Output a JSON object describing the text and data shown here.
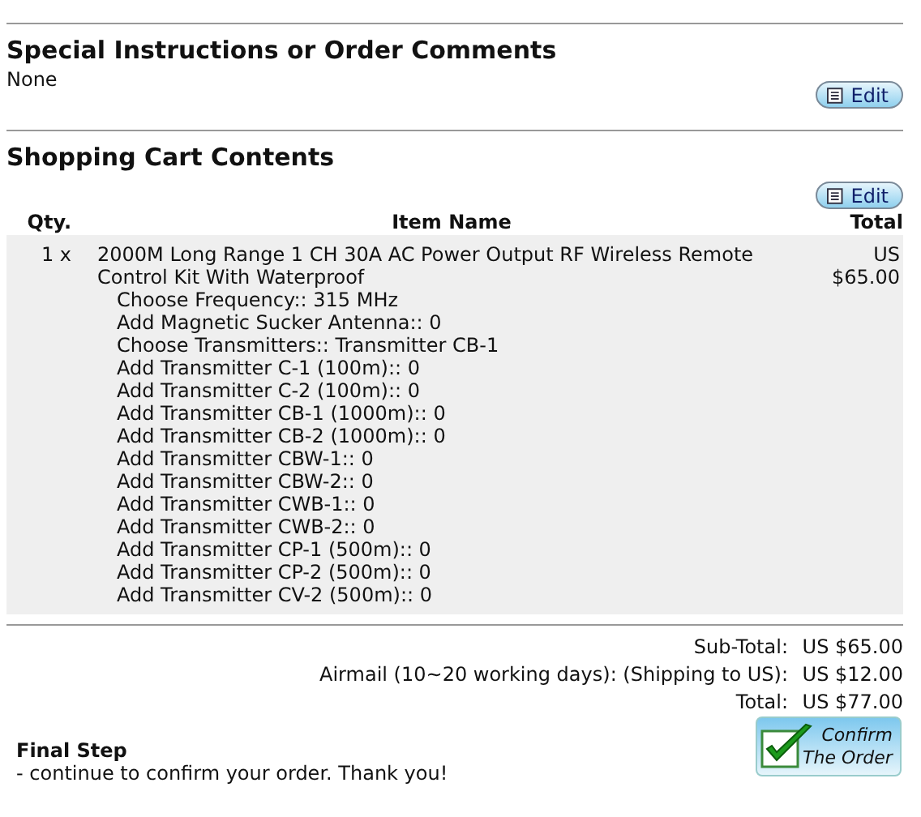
{
  "comments": {
    "title": "Special Instructions or Order Comments",
    "text": "None",
    "edit_button": "Edit"
  },
  "cart": {
    "title": "Shopping Cart Contents",
    "edit_button": "Edit",
    "columns": [
      "Qty.",
      "Item Name",
      "Total"
    ],
    "rows": [
      {
        "qty": "1 x",
        "name": "2000M Long Range 1 CH 30A AC Power Output RF Wireless Remote Control Kit With Waterproof",
        "total": "US $65.00",
        "options": [
          "Choose Frequency:: 315 MHz",
          "Add Magnetic Sucker Antenna:: 0",
          "Choose Transmitters:: Transmitter CB-1",
          "Add Transmitter C-1 (100m):: 0",
          "Add Transmitter C-2 (100m):: 0",
          "Add Transmitter CB-1 (1000m):: 0",
          "Add Transmitter CB-2 (1000m):: 0",
          "Add Transmitter CBW-1:: 0",
          "Add Transmitter CBW-2:: 0",
          "Add Transmitter CWB-1:: 0",
          "Add Transmitter CWB-2:: 0",
          "Add Transmitter CP-1 (500m):: 0",
          "Add Transmitter CP-2 (500m):: 0",
          "Add Transmitter CV-2 (500m):: 0"
        ]
      }
    ]
  },
  "totals": [
    {
      "label": "Sub-Total:",
      "value": "US $65.00"
    },
    {
      "label": "Airmail (10~20 working days): (Shipping to US):",
      "value": "US $12.00"
    },
    {
      "label": "Total:",
      "value": "US $77.00"
    }
  ],
  "final_step": {
    "title": "Final Step",
    "text": "- continue to confirm your order. Thank you!",
    "confirm_button": [
      "Confirm",
      "The Order"
    ]
  }
}
